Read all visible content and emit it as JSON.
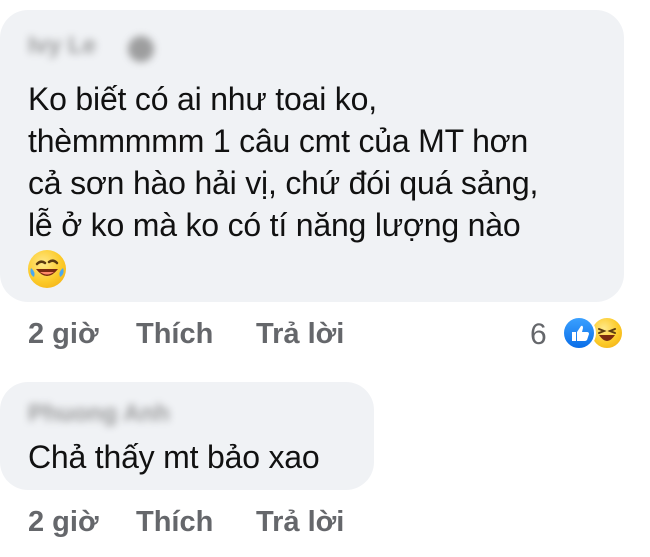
{
  "comments": [
    {
      "author": "Ivy Le",
      "text_lines": [
        "Ko biết có ai như toai ko,",
        "thèmmmmm 1 câu cmt của MT hơn",
        "cả sơn hào hải vị, chứ đói quá sảng,",
        "lễ ở ko mà ko có tí năng lượng nào"
      ],
      "emoji": "rofl-emoji",
      "time": "2 giờ",
      "like_label": "Thích",
      "reply_label": "Trả lời",
      "reaction_count": "6",
      "reaction_icons": [
        "like-icon",
        "haha-icon"
      ]
    },
    {
      "author": "Phuong Anh",
      "text_lines": [
        "Chả thấy mt bảo xao"
      ],
      "time": "2 giờ",
      "like_label": "Thích",
      "reply_label": "Trả lời"
    }
  ],
  "colors": {
    "bubble": "#f0f2f5",
    "action_text": "#65676b",
    "like_blue": "#1877f2",
    "emoji_yellow": "#fcca28"
  }
}
